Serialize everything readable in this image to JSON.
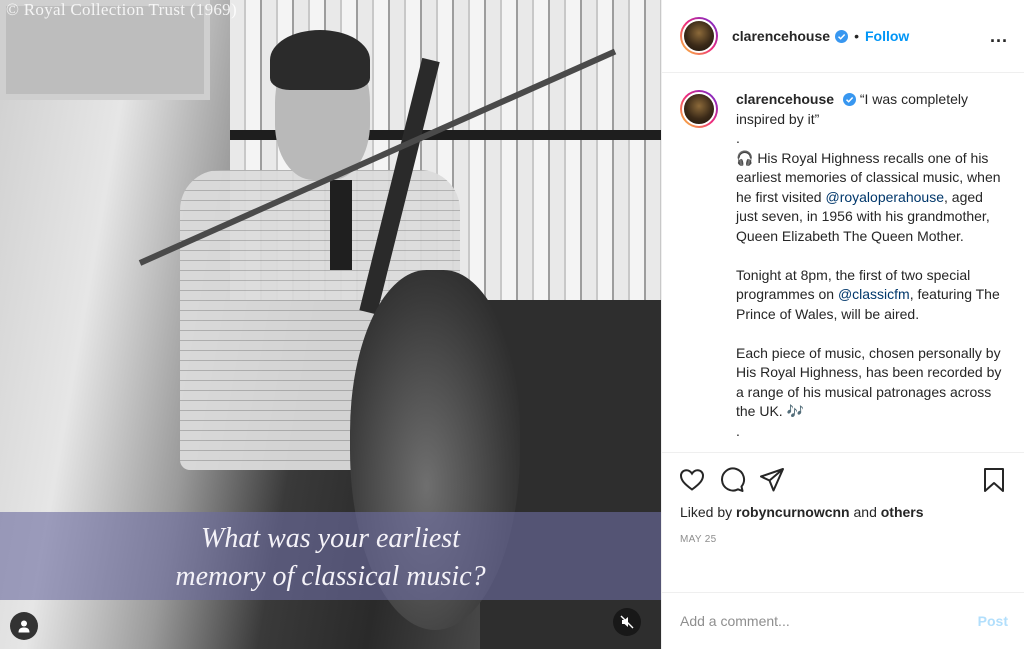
{
  "media": {
    "copyright": "© Royal Collection Trust (1969)",
    "caption_line1": "What was your earliest",
    "caption_line2": "memory of classical music?"
  },
  "header": {
    "username": "clarencehouse",
    "separator": "•",
    "follow_label": "Follow",
    "more_label": "..."
  },
  "caption": {
    "username": "clarencehouse",
    "quote": "“I was completely inspired by it”",
    "dot1": ".",
    "p1_a": "🎧 His Royal Highness recalls one of his earliest memories of classical music, when he first visited ",
    "p1_mention": "@royaloperahouse",
    "p1_b": ", aged just seven, in 1956 with his grandmother, Queen Elizabeth The Queen Mother.",
    "p2_a": "Tonight at 8pm, the first of two special programmes on ",
    "p2_mention": "@classicfm",
    "p2_b": ", featuring The Prince of Wales, will be aired.",
    "p3": "Each piece of music, chosen personally by His Royal Highness, has been recorded by a range of his musical patronages across the UK. 🎶",
    "dot2": "."
  },
  "actions": {
    "liked_by_prefix": "Liked by ",
    "liked_by_user": "robyncurnowcnn",
    "liked_by_and": " and ",
    "liked_by_others": "others",
    "date": "MAY 25"
  },
  "comment": {
    "placeholder": "Add a comment...",
    "post_label": "Post"
  },
  "colors": {
    "accent": "#0095f6",
    "post_disabled": "#b2dffc",
    "mention": "#00376b",
    "caption_band": "#6c6ca0"
  },
  "icons": [
    "user-tag-icon",
    "mute-icon",
    "verified-badge-icon",
    "heart-icon",
    "comment-icon",
    "share-icon",
    "bookmark-icon",
    "more-options-icon"
  ]
}
